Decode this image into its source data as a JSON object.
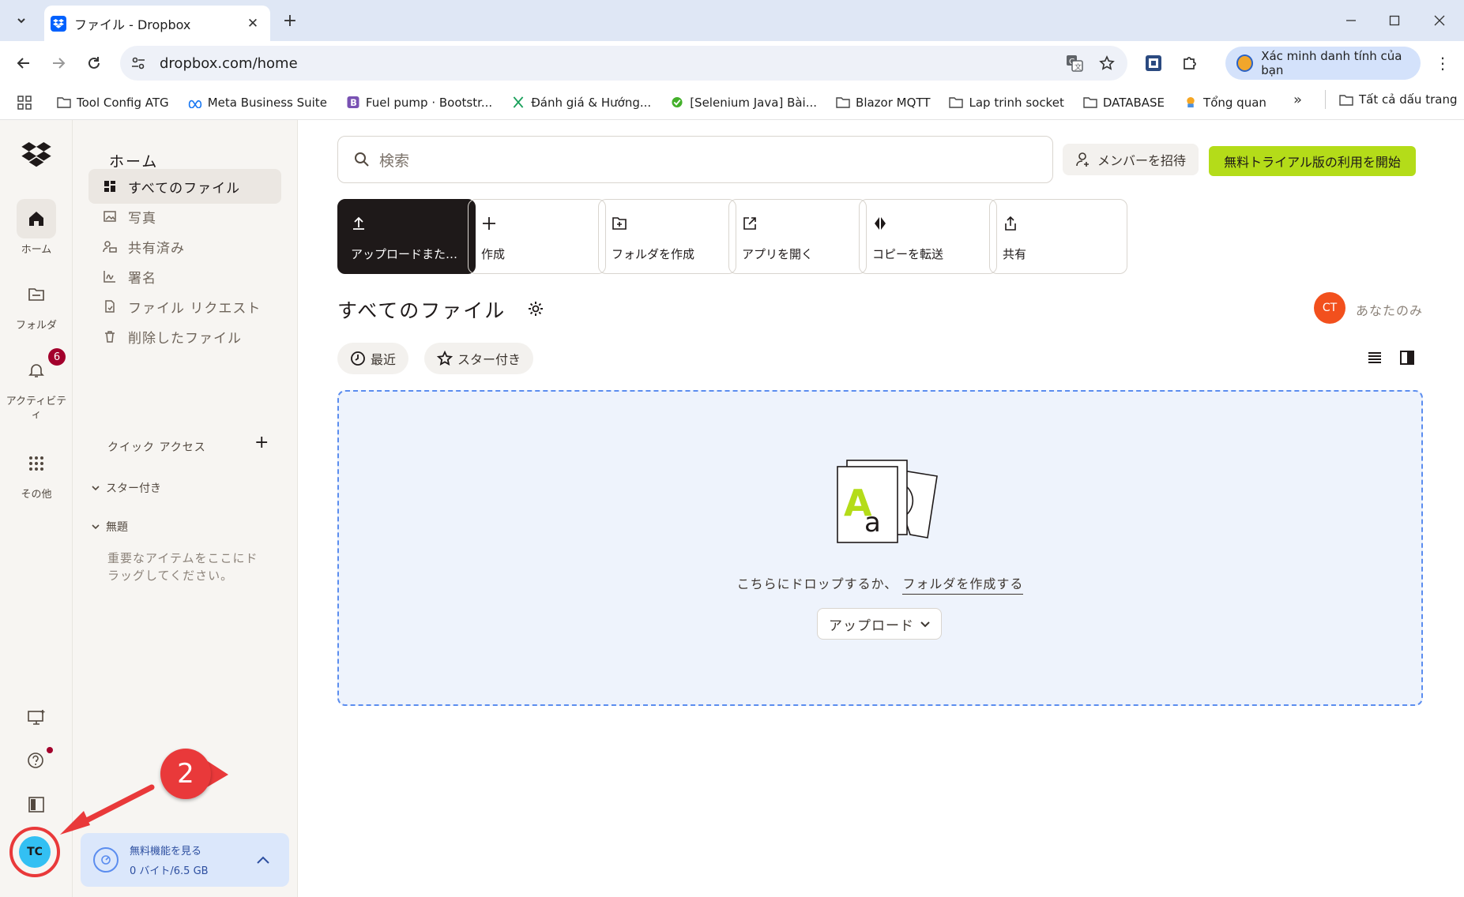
{
  "browser": {
    "tab_title": "ファイル - Dropbox",
    "url": "dropbox.com/home",
    "profile_label": "Xác minh danh tính của bạn",
    "bookmarks": [
      {
        "label": "Tool Config ATG",
        "icon": "folder-icon"
      },
      {
        "label": "Meta Business Suite",
        "icon": "meta-icon"
      },
      {
        "label": "Fuel pump · Bootstr...",
        "icon": "bootstrap-icon"
      },
      {
        "label": "Đánh giá & Hướng...",
        "icon": "x-logo-icon"
      },
      {
        "label": "[Selenium Java] Bài...",
        "icon": "selenium-icon"
      },
      {
        "label": "Blazor MQTT",
        "icon": "folder-icon"
      },
      {
        "label": "Lap trinh socket",
        "icon": "folder-icon"
      },
      {
        "label": "DATABASE",
        "icon": "folder-icon"
      },
      {
        "label": "Tổng quan",
        "icon": "overview-icon"
      }
    ],
    "all_bookmarks": "Tất cả dấu trang",
    "overflow": "»"
  },
  "rail": {
    "home": "ホーム",
    "folders": "フォルダ",
    "activity": "アクティビティ",
    "activity_badge": "6",
    "more": "その他",
    "avatar_initials": "TC"
  },
  "sidebar": {
    "title": "ホーム",
    "items": [
      {
        "label": "すべてのファイル",
        "icon": "all-files-icon",
        "active": true
      },
      {
        "label": "写真",
        "icon": "photo-icon"
      },
      {
        "label": "共有済み",
        "icon": "shared-icon"
      },
      {
        "label": "署名",
        "icon": "signature-icon"
      },
      {
        "label": "ファイル リクエスト",
        "icon": "file-request-icon"
      },
      {
        "label": "削除したファイル",
        "icon": "trash-icon"
      }
    ],
    "quick_access": "クイック アクセス",
    "starred": "スター付き",
    "untitled": "無題",
    "drag_hint": "重要なアイテムをここにドラッグしてください。",
    "storage_title": "無料機能を見る",
    "storage_usage": "0 バイト/6.5 GB"
  },
  "main": {
    "search_placeholder": "検索",
    "invite": "メンバーを招待",
    "trial": "無料トライアル版の利用を開始",
    "quick_actions": [
      {
        "label": "アップロードまたは作成",
        "icon": "upload-icon"
      },
      {
        "label": "作成",
        "icon": "plus-icon"
      },
      {
        "label": "フォルダを作成",
        "icon": "new-folder-icon"
      },
      {
        "label": "アプリを開く",
        "icon": "open-app-icon"
      },
      {
        "label": "コピーを転送",
        "icon": "transfer-icon"
      },
      {
        "label": "共有",
        "icon": "share-icon"
      }
    ],
    "files_title": "すべてのファイル",
    "owner_initials": "CT",
    "owner_label": "あなたのみ",
    "recent": "最近",
    "starred": "スター付き",
    "drop_text": "こちらにドロップするか、",
    "create_folder_link": "フォルダを作成する",
    "upload_button": "アップロード"
  },
  "annotation": {
    "step": "2"
  },
  "colors": {
    "accent_green": "#b4dc19",
    "annotation_red": "#e9393a",
    "avatar_blue": "#33c0f3",
    "owner_orange": "#f2501d"
  }
}
